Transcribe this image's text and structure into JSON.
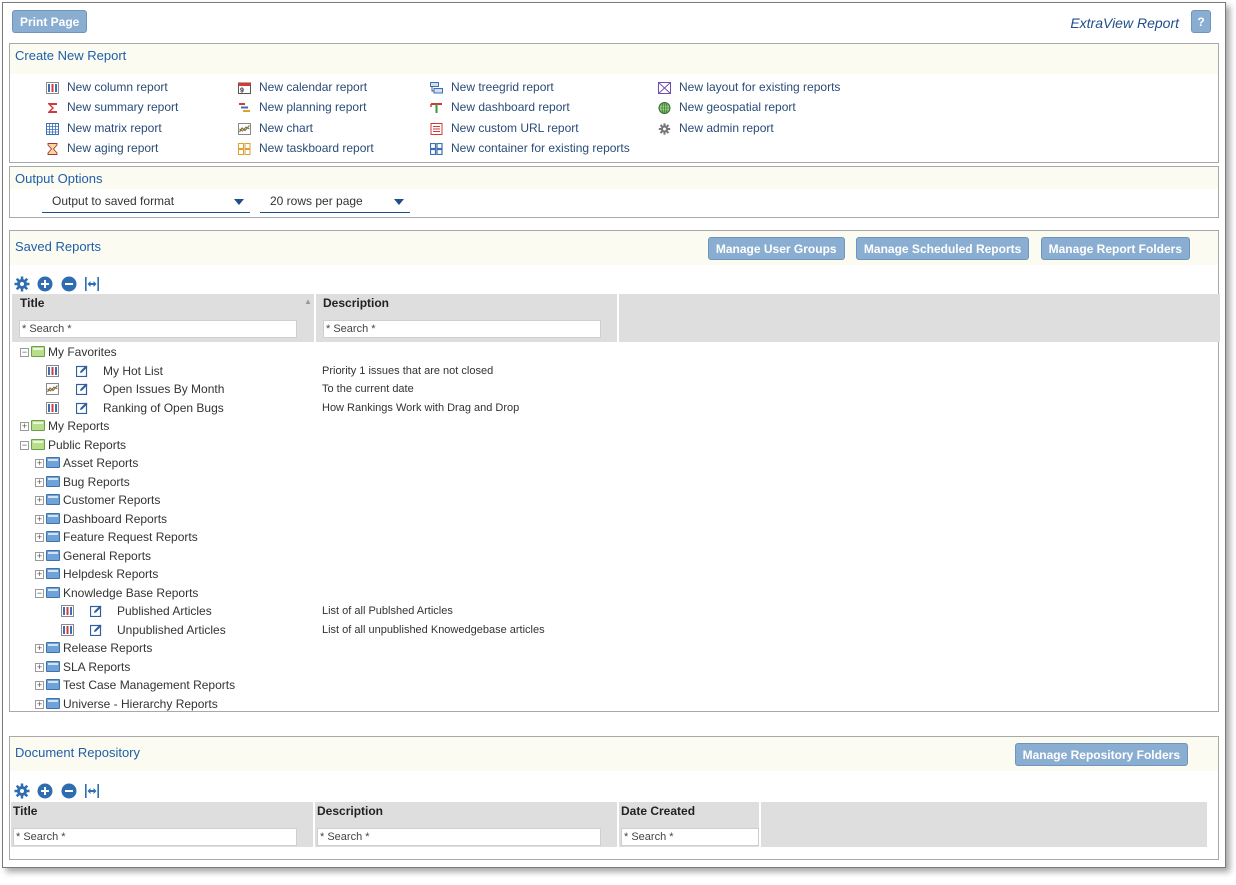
{
  "topbar": {
    "print_label": "Print Page",
    "app_title": "ExtraView Report",
    "help_label": "?"
  },
  "create": {
    "title": "Create New Report",
    "columns": [
      [
        {
          "label": "New column report",
          "icon": "column-report-icon"
        },
        {
          "label": "New summary report",
          "icon": "sigma-icon"
        },
        {
          "label": "New matrix report",
          "icon": "matrix-icon"
        },
        {
          "label": "New aging report",
          "icon": "hourglass-icon"
        }
      ],
      [
        {
          "label": "New calendar report",
          "icon": "calendar-icon"
        },
        {
          "label": "New planning report",
          "icon": "planning-icon"
        },
        {
          "label": "New chart",
          "icon": "chart-icon"
        },
        {
          "label": "New taskboard report",
          "icon": "taskboard-icon"
        }
      ],
      [
        {
          "label": "New treegrid report",
          "icon": "treegrid-icon"
        },
        {
          "label": "New dashboard report",
          "icon": "dashboard-icon"
        },
        {
          "label": "New custom URL report",
          "icon": "url-report-icon"
        },
        {
          "label": "New container for existing reports",
          "icon": "container-icon"
        }
      ],
      [
        {
          "label": "New layout for existing reports",
          "icon": "layout-icon"
        },
        {
          "label": "New geospatial report",
          "icon": "globe-icon"
        },
        {
          "label": "New admin report",
          "icon": "gear-icon"
        }
      ]
    ]
  },
  "output": {
    "title": "Output Options",
    "format_value": "Output to saved format",
    "rows_value": "20 rows per page"
  },
  "saved": {
    "title": "Saved Reports",
    "buttons": [
      "Manage User Groups",
      "Manage Scheduled Reports",
      "Manage Report Folders"
    ],
    "col_title": "Title",
    "col_description": "Description",
    "search_placeholder": "* Search *",
    "favorites": "My Favorites",
    "fav_items": [
      {
        "title": "My Hot List",
        "description": "Priority 1 issues that are not closed",
        "icon": "column-report-icon"
      },
      {
        "title": "Open Issues By Month",
        "description": "To the current date",
        "icon": "chart-icon"
      },
      {
        "title": "Ranking of Open Bugs",
        "description": "How Rankings Work with Drag and Drop",
        "icon": "column-report-icon"
      }
    ],
    "my_reports": "My Reports",
    "public_reports": "Public Reports",
    "public_folders": [
      "Asset Reports",
      "Bug Reports",
      "Customer Reports",
      "Dashboard Reports",
      "Feature Request Reports",
      "General Reports",
      "Helpdesk Reports",
      "Knowledge Base Reports"
    ],
    "kb_items": [
      {
        "title": "Published Articles",
        "description": "List of all Publshed Articles"
      },
      {
        "title": "Unpublished Articles",
        "description": "List of all unpublished Knowedgebase articles"
      }
    ],
    "public_folders_after": [
      "Release Reports",
      "SLA Reports",
      "Test Case Management Reports",
      "Universe - Hierarchy Reports"
    ]
  },
  "doc": {
    "title": "Document Repository",
    "button": "Manage Repository Folders",
    "col_title": "Title",
    "col_description": "Description",
    "col_date": "Date Created",
    "search_placeholder": "* Search *"
  }
}
